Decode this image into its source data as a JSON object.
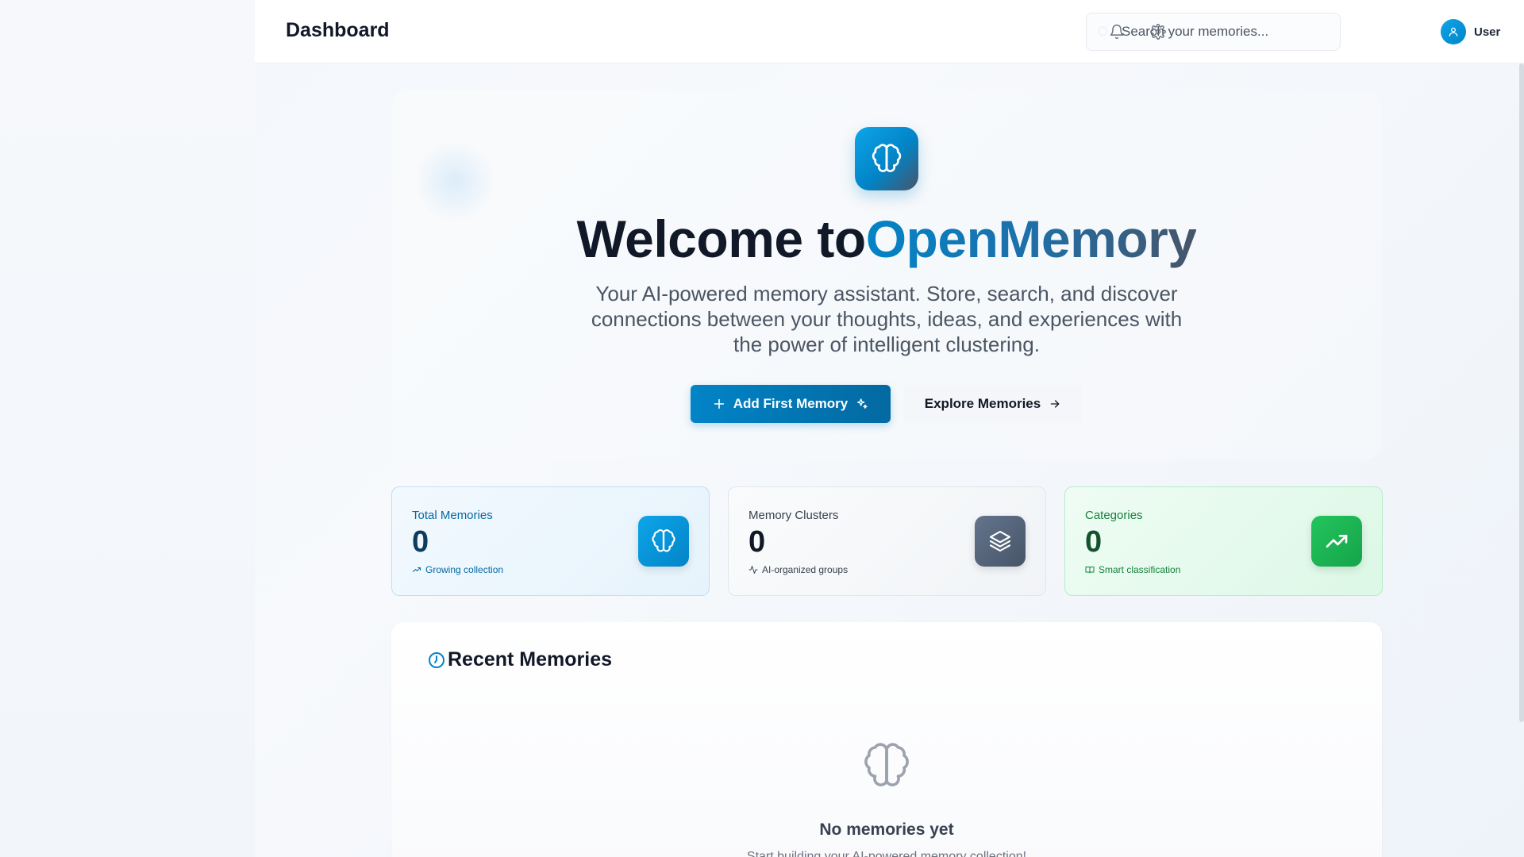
{
  "header": {
    "title": "Dashboard",
    "search_placeholder": "Search your memories...",
    "user_label": "User"
  },
  "hero": {
    "title_prefix": "Welcome to",
    "title_brand": "OpenMemory",
    "subtitle": "Your AI-powered memory assistant. Store, search, and discover connections between your thoughts, ideas, and experiences with the power of intelligent clustering.",
    "primary_button": "Add First Memory",
    "secondary_button": "Explore Memories"
  },
  "stats": [
    {
      "label": "Total Memories",
      "value": "0",
      "note": "Growing collection",
      "icon": "brain-icon",
      "accent": "#0284c7"
    },
    {
      "label": "Memory Clusters",
      "value": "0",
      "note": "AI-organized groups",
      "icon": "layers-icon",
      "accent": "#475569"
    },
    {
      "label": "Categories",
      "value": "0",
      "note": "Smart classification",
      "icon": "trending-up-icon",
      "accent": "#16a34a"
    }
  ],
  "recent": {
    "title": "Recent Memories",
    "empty_title": "No memories yet",
    "empty_subtitle": "Start building your AI-powered memory collection!"
  },
  "colors": {
    "brand_blue": "#0284c7",
    "brand_slate": "#475569",
    "success_green": "#16a34a"
  }
}
